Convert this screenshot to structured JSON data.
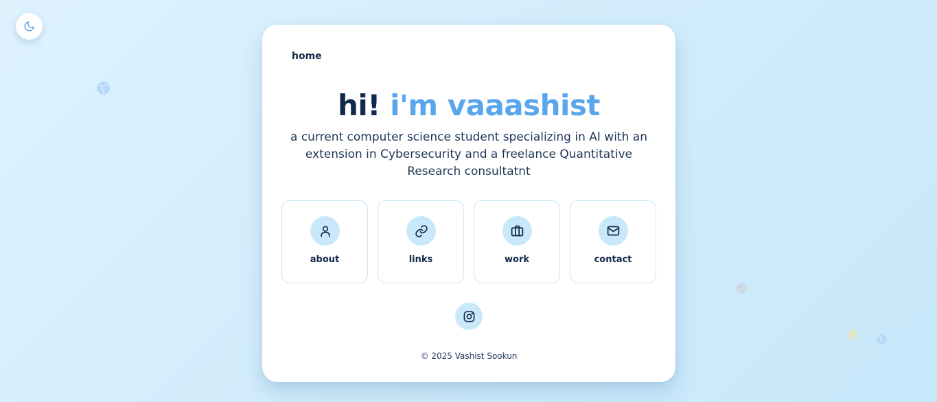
{
  "theme_toggle": {
    "icon": "moon-icon"
  },
  "nav": {
    "home_label": "home"
  },
  "hero": {
    "greeting": "hi!",
    "name": "i'm vaaashist",
    "bio": "a current computer science student specializing in AI with an extension in Cybersecurity and a freelance Quantitative Research consultatnt"
  },
  "tiles": [
    {
      "label": "about",
      "icon": "user-icon"
    },
    {
      "label": "links",
      "icon": "link-icon"
    },
    {
      "label": "work",
      "icon": "briefcase-icon"
    },
    {
      "label": "contact",
      "icon": "mail-icon"
    }
  ],
  "social": {
    "icon": "instagram-icon"
  },
  "footer": {
    "text": "© 2025 Vashist Sookun"
  },
  "colors": {
    "accent": "#5aa6ec",
    "dark_text": "#0f2a4e",
    "icon_circle": "#c9e9fa",
    "tile_border": "#c9e6f5"
  }
}
